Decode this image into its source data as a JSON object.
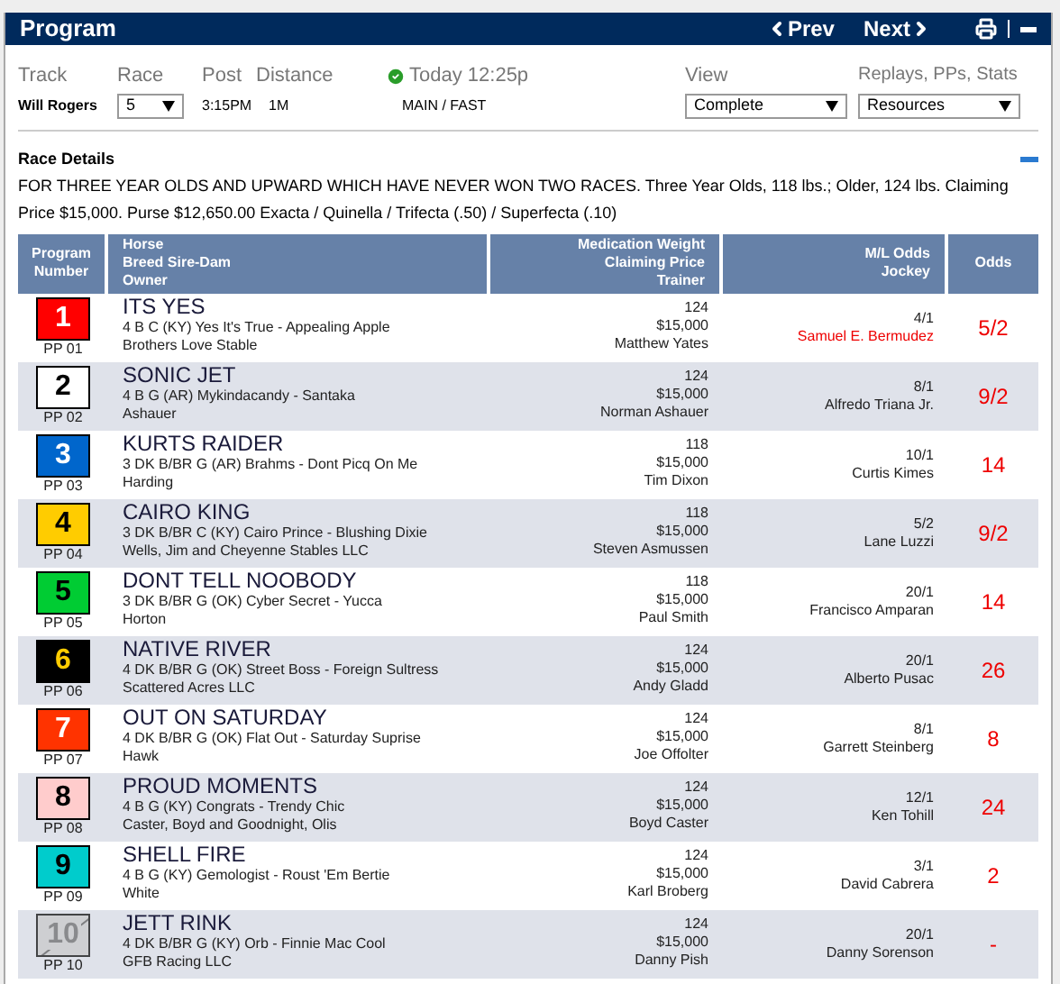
{
  "header": {
    "title": "Program",
    "prev": "Prev",
    "next": "Next"
  },
  "info": {
    "labels": [
      "Track",
      "Race",
      "Post",
      "Distance"
    ],
    "status": "Today 12:25p",
    "track": "Will Rogers",
    "race": "5",
    "post": "3:15PM",
    "distance": "1M",
    "surface": "MAIN / FAST",
    "view_label": "View",
    "view": "Complete",
    "resources_label": "Replays, PPs, Stats",
    "resources": "Resources"
  },
  "race_details": {
    "title": "Race Details",
    "text": "FOR THREE YEAR OLDS AND UPWARD WHICH HAVE NEVER WON TWO RACES. Three Year Olds, 118 lbs.; Older, 124 lbs. Claiming Price $15,000. Purse $12,650.00 Exacta / Quinella / Trifecta (.50) / Superfecta (.10)",
    "expanded": true
  },
  "table": {
    "columns": [
      [
        "Program",
        "Number"
      ],
      [
        "Horse",
        "Breed Sire-Dam",
        "Owner"
      ],
      [
        "Medication Weight",
        "Claiming Price",
        "Trainer"
      ],
      [
        "M/L Odds",
        "Jockey"
      ],
      [
        "Odds"
      ]
    ],
    "rows": [
      {
        "number": "1",
        "pp": "PP 01",
        "color": "#ff0000",
        "scratched": false,
        "horse": "ITS YES",
        "breed": "4 B C (KY) Yes It's True - Appealing Apple",
        "owner": "Brothers Love Stable",
        "weight": "124",
        "price": "$15,000",
        "trainer": "Matthew Yates",
        "ml": "4/1",
        "jockey": "Samuel E. Bermudez",
        "jockey_changed": true,
        "odds": "5/2"
      },
      {
        "number": "2",
        "pp": "PP 02",
        "color": "#ffffff",
        "scratched": false,
        "horse": "SONIC JET",
        "breed": "4 B G (AR) Mykindacandy - Santaka",
        "owner": "Ashauer",
        "weight": "124",
        "price": "$15,000",
        "trainer": "Norman Ashauer",
        "ml": "8/1",
        "jockey": "Alfredo Triana Jr.",
        "jockey_changed": false,
        "odds": "9/2"
      },
      {
        "number": "3",
        "pp": "PP 03",
        "color": "#0066cc",
        "scratched": false,
        "horse": "KURTS RAIDER",
        "breed": "3 DK B/BR G (AR) Brahms - Dont Picq On Me",
        "owner": "Harding",
        "weight": "118",
        "price": "$15,000",
        "trainer": "Tim Dixon",
        "ml": "10/1",
        "jockey": "Curtis Kimes",
        "jockey_changed": false,
        "odds": "14"
      },
      {
        "number": "4",
        "pp": "PP 04",
        "color": "#ffcc00",
        "scratched": false,
        "horse": "CAIRO KING",
        "breed": "3 DK B/BR C (KY) Cairo Prince - Blushing Dixie",
        "owner": "Wells, Jim and Cheyenne Stables LLC",
        "weight": "118",
        "price": "$15,000",
        "trainer": "Steven Asmussen",
        "ml": "5/2",
        "jockey": "Lane Luzzi",
        "jockey_changed": false,
        "odds": "9/2"
      },
      {
        "number": "5",
        "pp": "PP 05",
        "color": "#00cc33",
        "scratched": false,
        "horse": "DONT TELL NOOBODY",
        "breed": "3 DK B/BR G (OK) Cyber Secret - Yucca",
        "owner": "Horton",
        "weight": "118",
        "price": "$15,000",
        "trainer": "Paul Smith",
        "ml": "20/1",
        "jockey": "Francisco Amparan",
        "jockey_changed": false,
        "odds": "14"
      },
      {
        "number": "6",
        "pp": "PP 06",
        "color": "#000000",
        "scratched": false,
        "horse": "NATIVE RIVER",
        "breed": "4 DK B/BR G (OK) Street Boss - Foreign Sultress",
        "owner": "Scattered Acres LLC",
        "weight": "124",
        "price": "$15,000",
        "trainer": "Andy Gladd",
        "ml": "20/1",
        "jockey": "Alberto Pusac",
        "jockey_changed": false,
        "odds": "26"
      },
      {
        "number": "7",
        "pp": "PP 07",
        "color": "#ff3300",
        "scratched": false,
        "horse": "OUT ON SATURDAY",
        "breed": "4 DK B/BR G (OK) Flat Out - Saturday Suprise",
        "owner": "Hawk",
        "weight": "124",
        "price": "$15,000",
        "trainer": "Joe Offolter",
        "ml": "8/1",
        "jockey": "Garrett Steinberg",
        "jockey_changed": false,
        "odds": "8"
      },
      {
        "number": "8",
        "pp": "PP 08",
        "color": "#ffcccc",
        "scratched": false,
        "horse": "PROUD MOMENTS",
        "breed": "4 B G (KY) Congrats - Trendy Chic",
        "owner": "Caster, Boyd and Goodnight, Olis",
        "weight": "124",
        "price": "$15,000",
        "trainer": "Boyd Caster",
        "ml": "12/1",
        "jockey": "Ken Tohill",
        "jockey_changed": false,
        "odds": "24"
      },
      {
        "number": "9",
        "pp": "PP 09",
        "color": "#00cccc",
        "scratched": false,
        "horse": "SHELL FIRE",
        "breed": "4 B G (KY) Gemologist - Roust 'Em Bertie",
        "owner": "White",
        "weight": "124",
        "price": "$15,000",
        "trainer": "Karl Broberg",
        "ml": "3/1",
        "jockey": "David Cabrera",
        "jockey_changed": false,
        "odds": "2"
      },
      {
        "number": "10",
        "pp": "PP 10",
        "color": "#c8c8c8",
        "scratched": true,
        "horse": "JETT RINK",
        "breed": "4 DK B/BR G (KY) Orb - Finnie Mac Cool",
        "owner": "GFB Racing LLC",
        "weight": "124",
        "price": "$15,000",
        "trainer": "Danny Pish",
        "ml": "20/1",
        "jockey": "Danny Sorenson",
        "jockey_changed": false,
        "odds": "-"
      }
    ]
  }
}
